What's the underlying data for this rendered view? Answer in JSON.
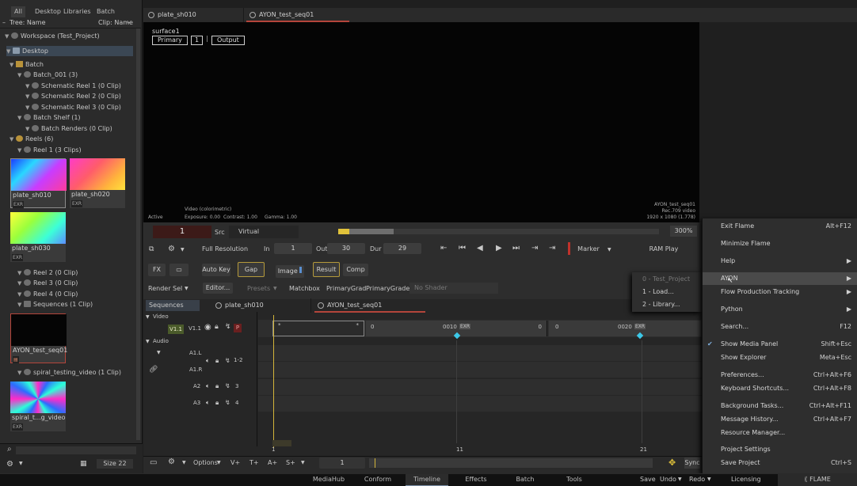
{
  "library": {
    "tabs": [
      "All",
      "Desktop",
      "Libraries",
      "Batch"
    ],
    "tree_header": "Tree: Name",
    "clip_header": "Clip: Name",
    "tree": [
      {
        "label": "Workspace (Test_Project)"
      },
      {
        "label": "Desktop"
      },
      {
        "label": "Batch"
      },
      {
        "label": "Batch_001 (3)"
      },
      {
        "label": "Schematic Reel 1 (0 Clip)"
      },
      {
        "label": "Schematic Reel 2 (0 Clip)"
      },
      {
        "label": "Schematic Reel 3 (0 Clip)"
      },
      {
        "label": "Batch Shelf (1)"
      },
      {
        "label": "Batch Renders (0 Clip)"
      },
      {
        "label": "Reels (6)"
      },
      {
        "label": "Reel 1 (3 Clips)"
      },
      {
        "label": "Reel 2 (0 Clip)"
      },
      {
        "label": "Reel 3 (0 Clip)"
      },
      {
        "label": "Reel 4 (0 Clip)"
      },
      {
        "label": "Sequences (1 Clip)"
      },
      {
        "label": "spiral_testing_video (1 Clip)"
      }
    ],
    "clips": [
      {
        "name": "plate_sh010",
        "badge": "EXR"
      },
      {
        "name": "plate_sh020",
        "badge": "EXR"
      },
      {
        "name": "plate_sh030",
        "badge": "EXR"
      },
      {
        "name": "AYON_test_seq01",
        "badge": ""
      },
      {
        "name": "spiral_t...g_video",
        "badge": "EXR"
      }
    ],
    "size_label": "Size 22"
  },
  "viewer": {
    "tabs": [
      "plate_sh010",
      "AYON_test_seq01"
    ],
    "surface": "surface1",
    "buttons": [
      "Primary",
      "1",
      "Output"
    ],
    "overlay_center": "Video (colorimetric)",
    "overlay_active": "Active",
    "exposure": "Exposure: 0.00",
    "contrast": "Contrast: 1.00",
    "gamma": "Gamma: 1.00",
    "info_name": "AYON_test_seq01",
    "info_res": "Rec.709 video",
    "info_size": "1920 x 1080 (1.778)"
  },
  "controls": {
    "frame": "1",
    "src": "Src",
    "virtual": "Virtual",
    "zoom": "300%",
    "full_res": "Full Resolution",
    "in_label": "In",
    "in_val": "1",
    "out_label": "Out",
    "out_val": "30",
    "dur_label": "Dur",
    "dur_val": "29",
    "marker": "Marker",
    "ram_play": "RAM Play",
    "fx": "FX",
    "auto_key": "Auto Key",
    "gap": "Gap",
    "image": "Image",
    "result": "Result",
    "comp": "Comp",
    "render_sel": "Render Sel",
    "editor": "Editor...",
    "presets": "Presets",
    "matchbox": "Matchbox",
    "primary_grad": "PrimaryGrad",
    "primary_grade": "PrimaryGrade",
    "no_shader": "No Shader"
  },
  "timeline": {
    "sequences": "Sequences",
    "tabs": [
      "plate_sh010",
      "AYON_test_seq01"
    ],
    "video": "Video",
    "audio": "Audio",
    "v_track": "V1.1",
    "v_label": "V1.1",
    "p_badge": "P",
    "a_tracks": [
      {
        "name": "A1.L",
        "num": ""
      },
      {
        "name": "A1.R",
        "num": "1-2"
      },
      {
        "name": "A2",
        "num": "3"
      },
      {
        "name": "A3",
        "num": "4"
      }
    ],
    "clip1": {
      "left": "0",
      "right": "0010",
      "badge": "EXR",
      "end": "0"
    },
    "clip2": {
      "left": "0",
      "right": "0020",
      "badge": "EXR"
    },
    "ruler": [
      "1",
      "11",
      "21"
    ],
    "frame_field": "1",
    "options": "Options",
    "sync": "Sync"
  },
  "menu": {
    "items": [
      {
        "label": "Exit Flame",
        "shortcut": "Alt+F12"
      },
      {
        "label": "Minimize Flame",
        "shortcut": ""
      },
      {
        "label": "Help",
        "shortcut": ""
      },
      {
        "label": "AYON",
        "shortcut": ""
      },
      {
        "label": "Flow Production Tracking",
        "shortcut": ""
      },
      {
        "label": "Python",
        "shortcut": ""
      },
      {
        "label": "Search...",
        "shortcut": "F12"
      },
      {
        "label": "Show Media Panel",
        "shortcut": "Shift+Esc"
      },
      {
        "label": "Show Explorer",
        "shortcut": "Meta+Esc"
      },
      {
        "label": "Preferences...",
        "shortcut": "Ctrl+Alt+F6"
      },
      {
        "label": "Keyboard Shortcuts...",
        "shortcut": "Ctrl+Alt+F8"
      },
      {
        "label": "Background Tasks...",
        "shortcut": "Ctrl+Alt+F11"
      },
      {
        "label": "Message History...",
        "shortcut": "Ctrl+Alt+F7"
      },
      {
        "label": "Resource Manager...",
        "shortcut": ""
      },
      {
        "label": "Project Settings",
        "shortcut": ""
      },
      {
        "label": "Save Project",
        "shortcut": "Ctrl+S"
      }
    ],
    "submenu": [
      "0 - Test_Project",
      "1 - Load...",
      "2 - Library..."
    ]
  },
  "statusbar": {
    "tabs": [
      "MediaHub",
      "Conform",
      "Timeline",
      "Effects",
      "Batch",
      "Tools"
    ],
    "active": "Timeline",
    "save": "Save",
    "undo": "Undo",
    "redo": "Redo",
    "licensing": "Licensing",
    "brand": "FLAME"
  },
  "colors": {
    "accent": "#e0c23a",
    "marker_red": "#c0322b",
    "selection": "#7b8fa6"
  }
}
